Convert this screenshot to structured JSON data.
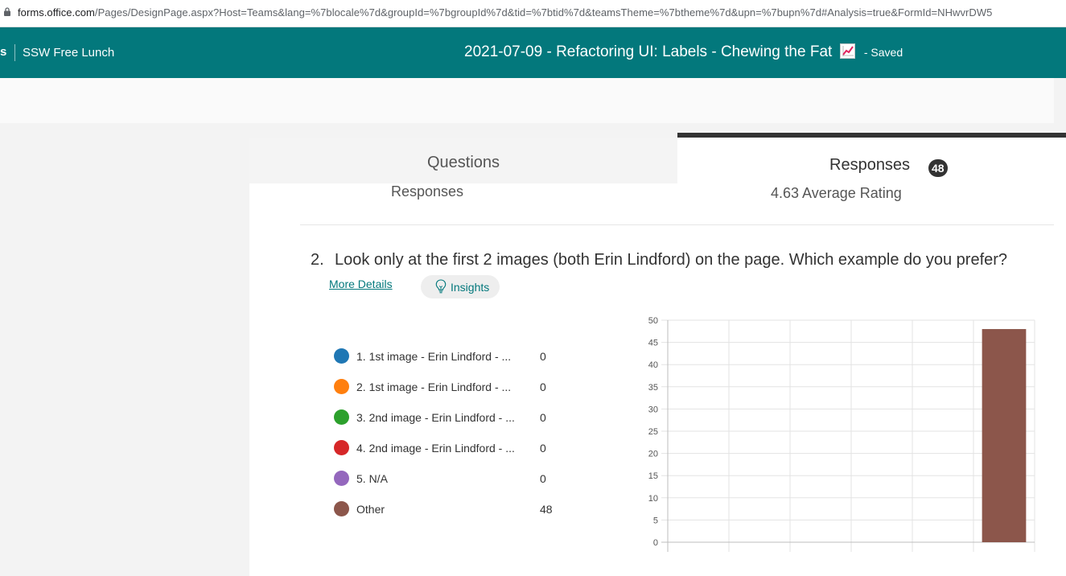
{
  "browser": {
    "url_host": "forms.office.com",
    "url_rest": "/Pages/DesignPage.aspx?Host=Teams&lang=%7blocale%7d&groupId=%7bgroupId%7d&tid=%7btid%7d&teamsTheme=%7btheme%7d&upn=%7bupn%7d#Analysis=true&FormId=NHwvrDW5"
  },
  "header": {
    "app_fragment": "s",
    "group_name": "SSW Free Lunch",
    "form_title": "2021-07-09 - Refactoring UI: Labels - Chewing the Fat",
    "title_icon": "chart-increasing-emoji",
    "save_status": "- Saved",
    "color": "#03787c"
  },
  "tabs": {
    "questions": "Questions",
    "responses": "Responses",
    "responses_count": "48"
  },
  "summary": {
    "responses_label": "Responses",
    "average_rating": "4.63 Average Rating"
  },
  "question": {
    "number": "2.",
    "text": "Look only at the first 2 images (both Erin Lindford) on the page. Which example do you prefer?",
    "more_details": "More Details",
    "insights": "Insights",
    "insights_icon": "lightbulb-icon",
    "options": [
      {
        "label": "1. 1st image - Erin Lindford - ...",
        "count": "0",
        "color": "#1f77b4"
      },
      {
        "label": "2. 1st image - Erin Lindford - ...",
        "count": "0",
        "color": "#ff7f0e"
      },
      {
        "label": "3. 2nd image - Erin Lindford - ...",
        "count": "0",
        "color": "#2ca02c"
      },
      {
        "label": "4. 2nd image - Erin Lindford - ...",
        "count": "0",
        "color": "#d62728"
      },
      {
        "label": "5. N/A",
        "count": "0",
        "color": "#9467bd"
      },
      {
        "label": "Other",
        "count": "48",
        "color": "#8c564b"
      }
    ]
  },
  "chart_data": {
    "type": "bar",
    "categories": [
      "1",
      "2",
      "3",
      "4",
      "5",
      "Other"
    ],
    "values": [
      0,
      0,
      0,
      0,
      0,
      48
    ],
    "colors": [
      "#1f77b4",
      "#ff7f0e",
      "#2ca02c",
      "#d62728",
      "#9467bd",
      "#8c564b"
    ],
    "ylim": [
      0,
      50
    ],
    "yticks": [
      "0",
      "5",
      "10",
      "15",
      "20",
      "25",
      "30",
      "35",
      "40",
      "45",
      "50"
    ],
    "grid": true,
    "title": "",
    "xlabel": "",
    "ylabel": ""
  }
}
